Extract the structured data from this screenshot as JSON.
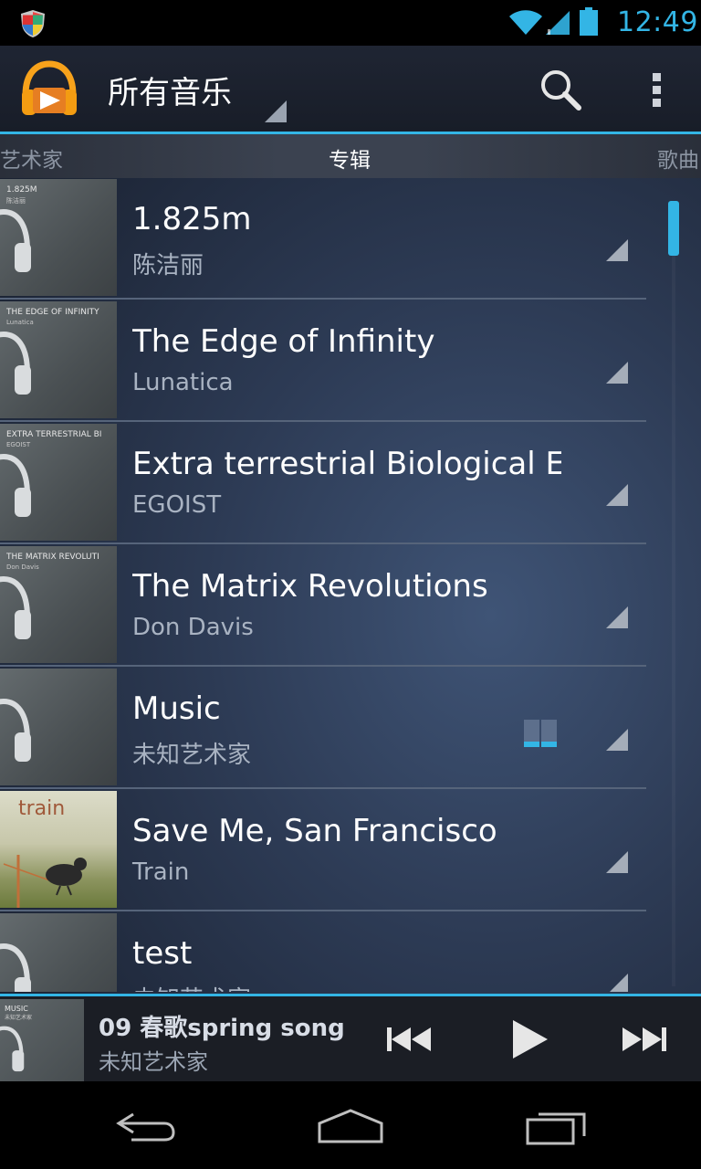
{
  "status_bar": {
    "time": "12:49"
  },
  "action_bar": {
    "title": "所有音乐"
  },
  "tabs": {
    "left": "艺术家",
    "center": "专辑",
    "right": "歌曲"
  },
  "albums": [
    {
      "name": "1.825m",
      "artist": "陈洁丽",
      "thumb_title": "1.825M",
      "thumb_sub": "陈洁丽"
    },
    {
      "name": "The Edge of Infinity",
      "artist": "Lunatica",
      "thumb_title": "THE EDGE OF INFINITY",
      "thumb_sub": "Lunatica"
    },
    {
      "name": "Extra terrestrial Biological E..",
      "artist": "EGOIST",
      "thumb_title": "EXTRA TERRESTRIAL BI",
      "thumb_sub": "EGOIST"
    },
    {
      "name": "The Matrix Revolutions",
      "artist": "Don Davis",
      "thumb_title": "THE MATRIX REVOLUTI",
      "thumb_sub": "Don Davis"
    },
    {
      "name": "Music",
      "artist": "未知艺术家",
      "thumb_title": "",
      "thumb_sub": ""
    },
    {
      "name": "Save Me, San Francisco",
      "artist": "Train",
      "thumb_title": "train",
      "thumb_sub": ""
    },
    {
      "name": "test",
      "artist": "未知艺术家",
      "thumb_title": "",
      "thumb_sub": ""
    }
  ],
  "now_playing": {
    "title": "09 春歌spring song",
    "artist": "未知艺术家",
    "thumb_title": "MUSIC",
    "thumb_sub": "未知艺术家"
  },
  "colors": {
    "accent": "#33b5e5"
  }
}
